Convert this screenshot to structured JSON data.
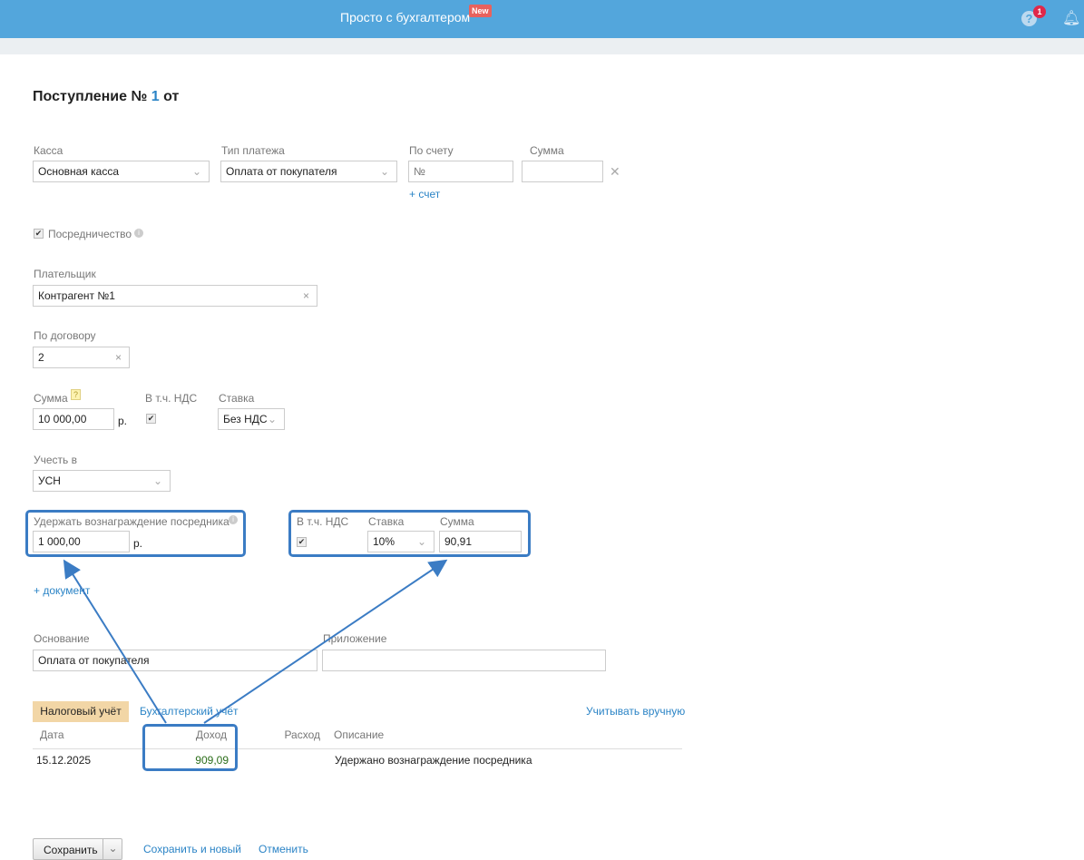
{
  "header": {
    "brand": "Просто с бухгалтером",
    "new_badge": "New",
    "help": "?",
    "notifications_count": "1"
  },
  "title": {
    "prefix": "Поступление №",
    "number": "1",
    "suffix": "от"
  },
  "kassa": {
    "label": "Касса",
    "value": "Основная касса"
  },
  "payment_type": {
    "label": "Тип платежа",
    "value": "Оплата от покупателя"
  },
  "invoice": {
    "label": "По счету",
    "placeholder": "№",
    "add": "+ счет"
  },
  "invoice_sum": {
    "label": "Сумма",
    "value": ""
  },
  "mediation": {
    "label": "Посредничество",
    "checked": true
  },
  "payer": {
    "label": "Плательщик",
    "value": "Контрагент №1"
  },
  "contract": {
    "label": "По договору",
    "value": "2"
  },
  "amount": {
    "label": "Сумма",
    "hint": "?",
    "value": "10 000,00",
    "currency": "р."
  },
  "vat_incl": {
    "label": "В т.ч. НДС",
    "checked": true
  },
  "rate": {
    "label": "Ставка",
    "value": "Без НДС"
  },
  "account_in": {
    "label": "Учесть в",
    "value": "УСН"
  },
  "fee": {
    "label": "Удержать вознаграждение посредника",
    "value": "1 000,00",
    "currency": "р."
  },
  "fee_vat": {
    "vat_label": "В т.ч. НДС",
    "checked": true,
    "rate_label": "Ставка",
    "rate": "10%",
    "sum_label": "Сумма",
    "sum": "90,91"
  },
  "add_document": "+ документ",
  "basis": {
    "label": "Основание",
    "value": "Оплата от покупателя"
  },
  "attachment": {
    "label": "Приложение",
    "value": ""
  },
  "tabs": {
    "tax": "Налоговый учёт",
    "accounting": "Бухгалтерский учёт",
    "manual": "Учитывать вручную"
  },
  "table": {
    "headers": [
      "Дата",
      "Доход",
      "Расход",
      "Описание"
    ],
    "rows": [
      {
        "date": "15.12.2025",
        "income": "909,09",
        "expense": "",
        "desc": "Удержано вознаграждение посредника"
      }
    ]
  },
  "footer": {
    "save": "Сохранить",
    "save_new": "Сохранить и новый",
    "cancel": "Отменить"
  }
}
